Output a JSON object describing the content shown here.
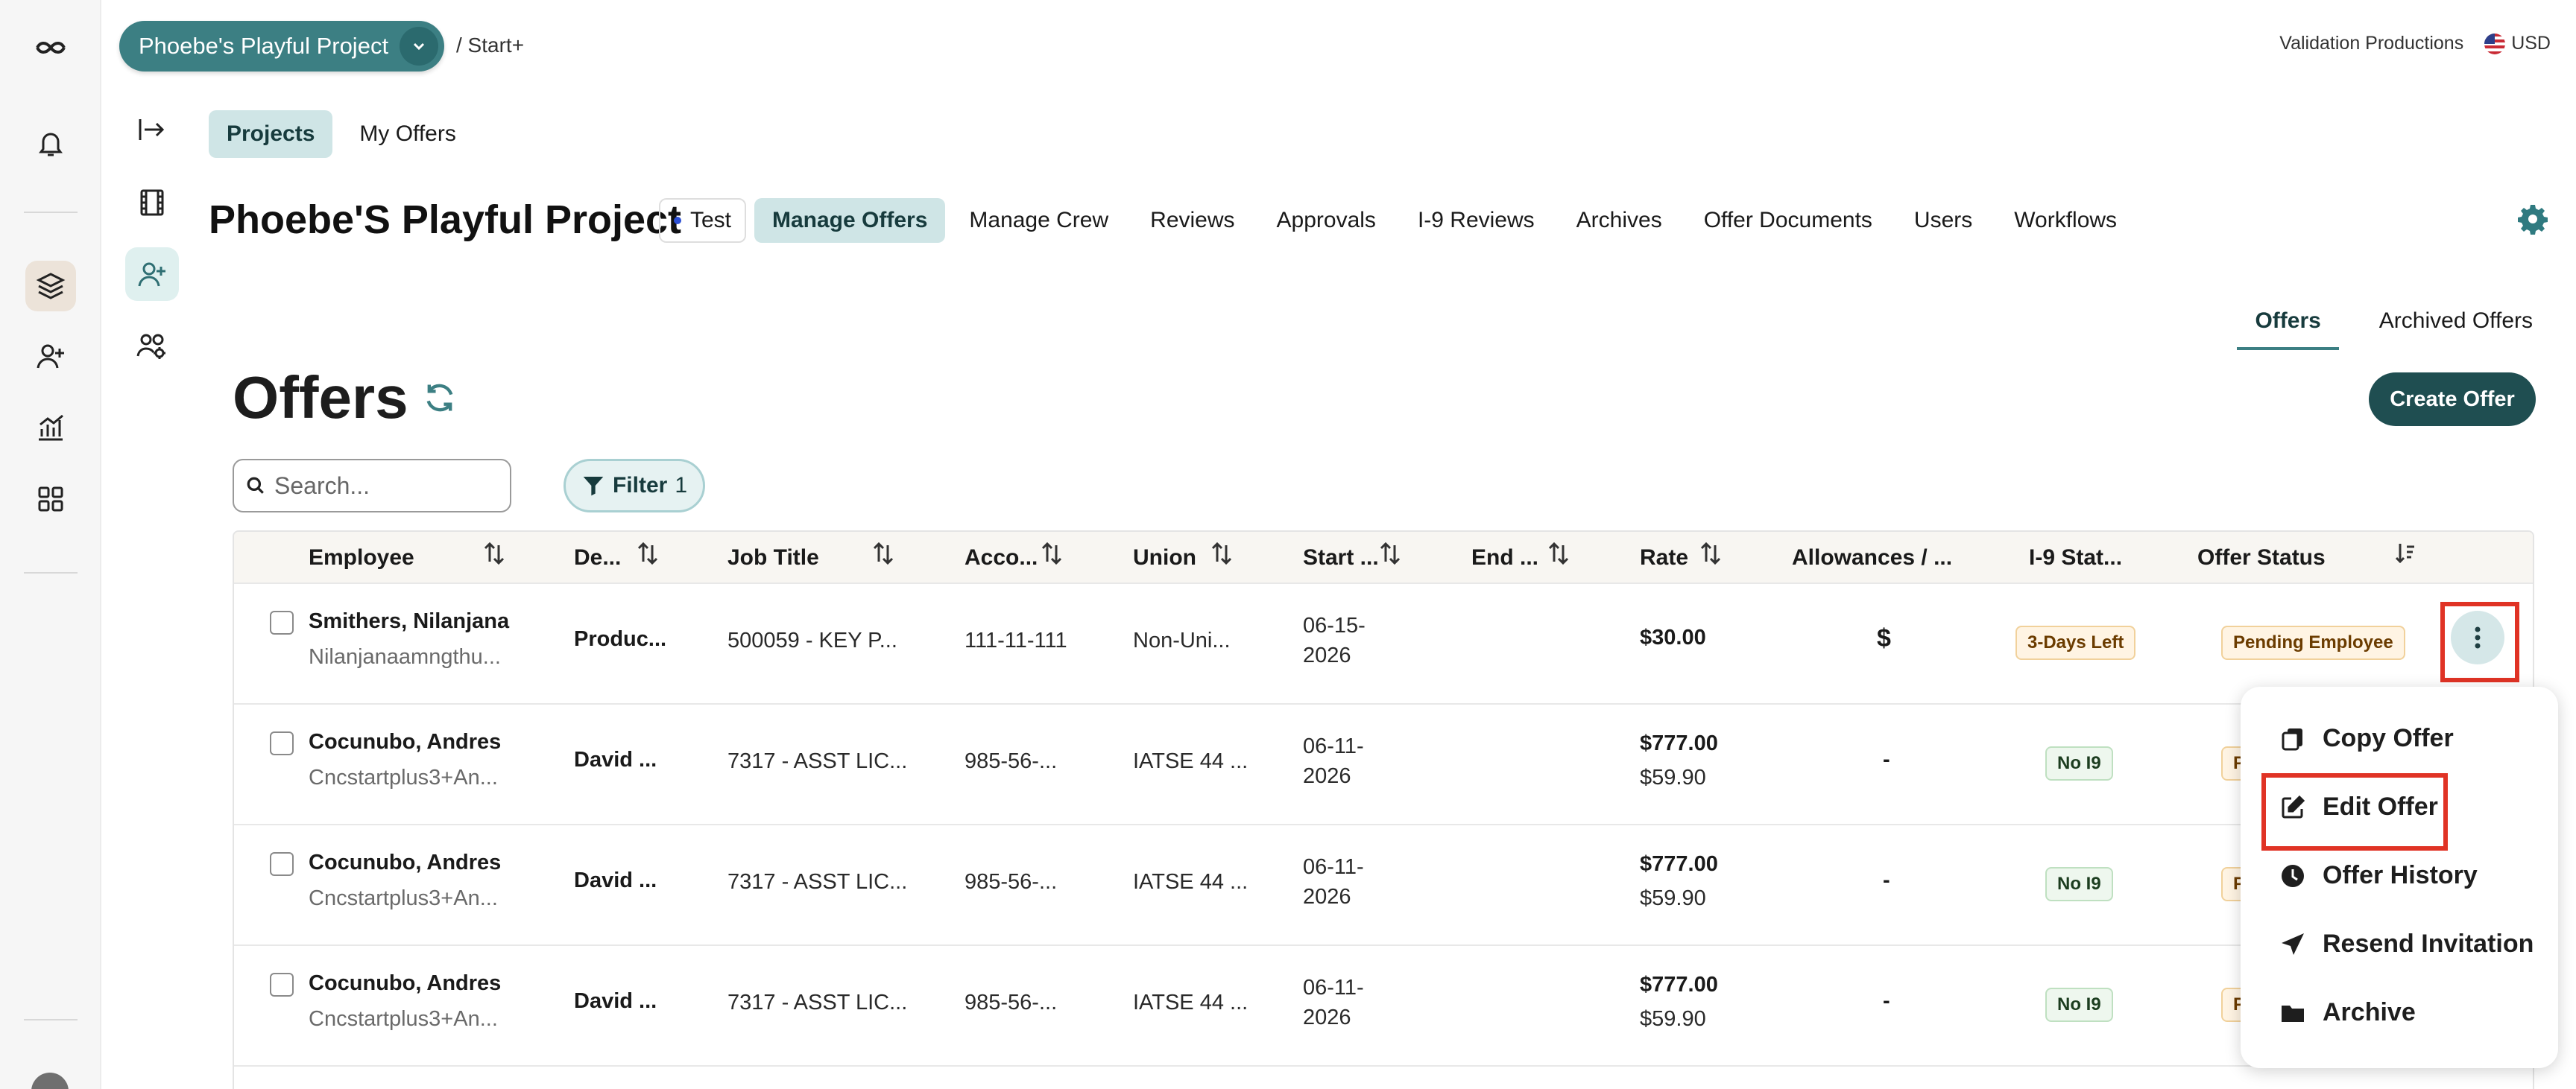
{
  "header": {
    "project_selector": "Phoebe's Playful Project",
    "breadcrumb": "/ Start+",
    "company": "Validation Productions",
    "currency": "USD"
  },
  "nav_tabs": {
    "projects": "Projects",
    "my_offers": "My Offers"
  },
  "project": {
    "title": "Phoebe'S Playful Project",
    "badge": "Test",
    "nav": [
      "Manage Offers",
      "Manage Crew",
      "Reviews",
      "Approvals",
      "I-9 Reviews",
      "Archives",
      "Offer Documents",
      "Users",
      "Workflows"
    ],
    "active_nav": "Manage Offers"
  },
  "offers_tabs": {
    "offers": "Offers",
    "archived": "Archived Offers"
  },
  "page": {
    "title": "Offers",
    "create_label": "Create Offer",
    "search_placeholder": "Search...",
    "filter_label": "Filter",
    "filter_count": "1"
  },
  "table": {
    "columns": [
      "Employee",
      "De...",
      "Job Title",
      "Acco...",
      "Union",
      "Start ...",
      "End ...",
      "Rate",
      "Allowances / ...",
      "I-9 Stat...",
      "Offer Status"
    ],
    "rows": [
      {
        "name": "Smithers, Nilanjana",
        "email": "Nilanjanaamngthu...",
        "dept": "Produc...",
        "job": "500059 - KEY P...",
        "account": "111-11-111",
        "union": "Non-Uni...",
        "start1": "06-15-",
        "start2": "2026",
        "rate": "$30.00",
        "rate2": "",
        "allow": "$",
        "i9": "3-Days Left",
        "status": "Pending Employee"
      },
      {
        "name": "Cocunubo, Andres",
        "email": "Cncstartplus3+An...",
        "dept": "David ...",
        "job": "7317 - ASST LIC...",
        "account": "985-56-...",
        "union": "IATSE 44 ...",
        "start1": "06-11-",
        "start2": "2026",
        "rate": "$777.00",
        "rate2": "$59.90",
        "allow": "-",
        "i9": "No I9",
        "status": "P"
      },
      {
        "name": "Cocunubo, Andres",
        "email": "Cncstartplus3+An...",
        "dept": "David ...",
        "job": "7317 - ASST LIC...",
        "account": "985-56-...",
        "union": "IATSE 44 ...",
        "start1": "06-11-",
        "start2": "2026",
        "rate": "$777.00",
        "rate2": "$59.90",
        "allow": "-",
        "i9": "No I9",
        "status": "P"
      },
      {
        "name": "Cocunubo, Andres",
        "email": "Cncstartplus3+An...",
        "dept": "David ...",
        "job": "7317 - ASST LIC...",
        "account": "985-56-...",
        "union": "IATSE 44 ...",
        "start1": "06-11-",
        "start2": "2026",
        "rate": "$777.00",
        "rate2": "$59.90",
        "allow": "-",
        "i9": "No I9",
        "status": "P"
      }
    ]
  },
  "menu": [
    "Copy Offer",
    "Edit Offer",
    "Offer History",
    "Resend Invitation",
    "Archive"
  ],
  "colors": {
    "brand_teal": "#3c7f83",
    "dark_teal": "#1f4e51",
    "highlight_red": "#e03325"
  }
}
